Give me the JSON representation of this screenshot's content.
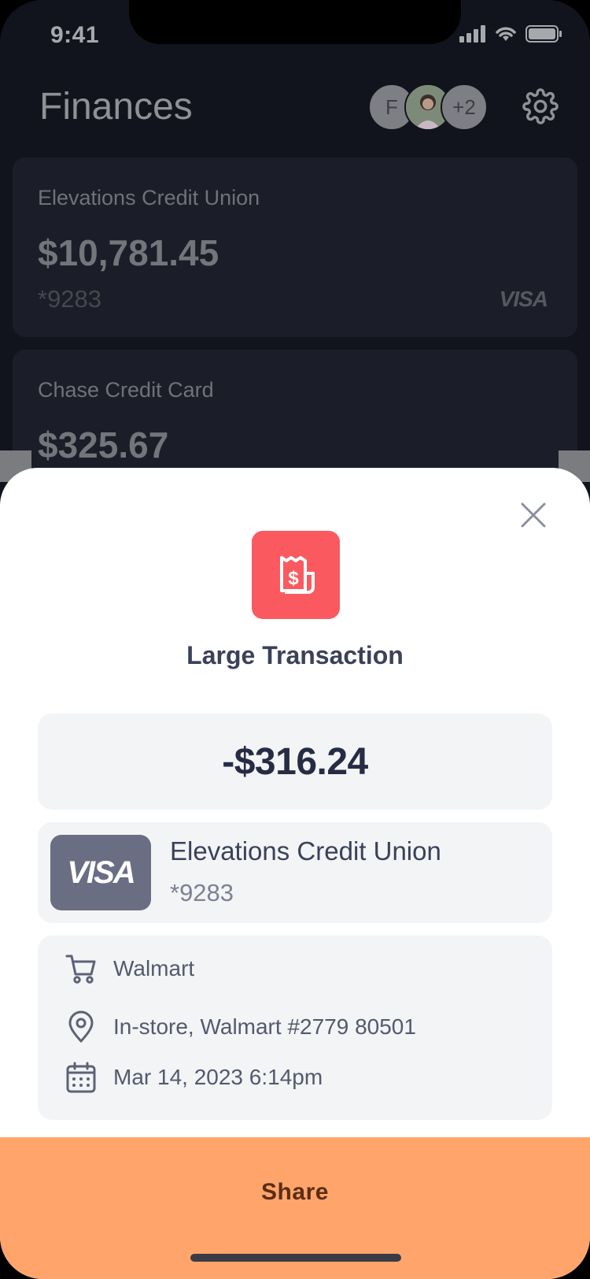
{
  "status": {
    "time": "9:41"
  },
  "header": {
    "title": "Finances",
    "avatars": {
      "first_initial": "F",
      "more_count": "+2"
    }
  },
  "accounts": [
    {
      "name": "Elevations Credit Union",
      "balance": "$10,781.45",
      "mask": "*9283",
      "network": "VISA"
    },
    {
      "name": "Chase Credit Card",
      "balance": "$325.67"
    }
  ],
  "sheet": {
    "title": "Large Transaction",
    "amount": "-$316.24",
    "card": {
      "network": "VISA",
      "name": "Elevations Credit Union",
      "mask": "*9283"
    },
    "details": {
      "merchant": "Walmart",
      "location": "In-store, Walmart #2779 80501",
      "datetime": "Mar 14, 2023 6:14pm"
    },
    "share_label": "Share"
  },
  "colors": {
    "alert_red": "#fa5a5f",
    "share_orange": "#ffa56c",
    "background_dark": "#12141d"
  }
}
